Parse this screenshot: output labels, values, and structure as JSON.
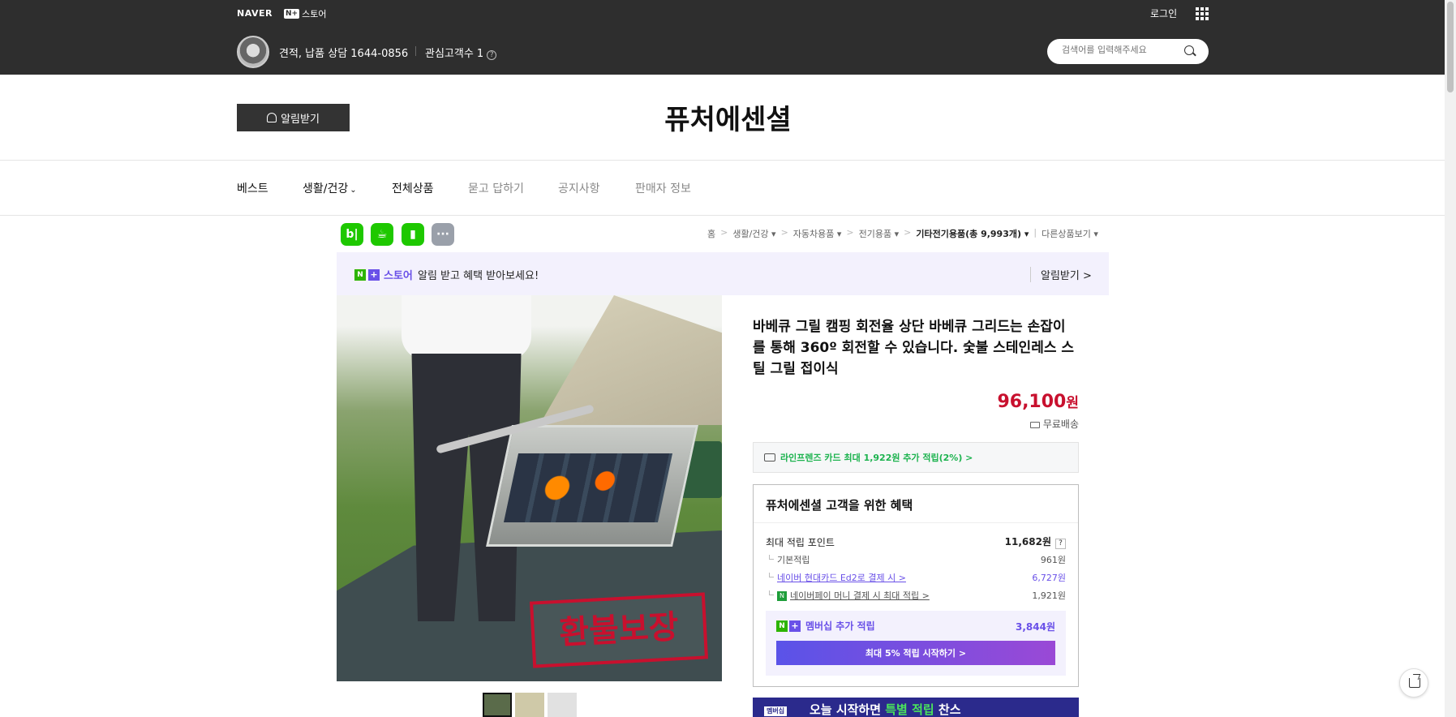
{
  "top": {
    "naver_logo": "NAVER",
    "nplus_mark": "N+",
    "nplus_label": "스토어",
    "login": "로그인",
    "consult": "견적, 납품 상담 1644-0856",
    "fans": "관심고객수 1",
    "search_placeholder": "검색어를 입력해주세요"
  },
  "store": {
    "alarm_button": "알림받기",
    "name": "퓨처에센셜"
  },
  "nav": {
    "items": [
      {
        "label": "베스트"
      },
      {
        "label": "생활/건강"
      },
      {
        "label": "전체상품"
      },
      {
        "label": "묻고 답하기"
      },
      {
        "label": "공지사항"
      },
      {
        "label": "판매자 정보"
      }
    ]
  },
  "social": {
    "blog": "b|",
    "more": "···"
  },
  "breadcrumb": {
    "items": [
      "홈",
      "생활/건강",
      "자동차용품",
      "전기용품",
      "기타전기용품(총 9,993개)",
      "다른상품보기"
    ]
  },
  "banner": {
    "mark": "N",
    "plus": "+",
    "store_word": "스토어",
    "message": "알림 받고 혜택 받아보세요!",
    "right": "알림받기 >"
  },
  "product": {
    "image_stamp": "환불보장",
    "title": "바베큐 그릴 캠핑 회전율 상단 바베큐 그리드는 손잡이를 통해 360º 회전할 수 있습니다. 숯불 스테인레스 스틸 그릴 접이식",
    "price": "96,100",
    "price_unit": "원",
    "shipping": "무료배송",
    "card_offer": "라인프렌즈 카드 최대 1,922원 추가 적립(2%) >"
  },
  "benefit": {
    "head": "퓨처에센셜 고객을 위한 혜택",
    "max_label": "최대 적립 포인트",
    "max_value": "11,682원",
    "q": "?",
    "basic_label": "기본적립",
    "basic_value": "961원",
    "hyundai_label": "네이버 현대카드 Ed2로 결제 시 >",
    "hyundai_value": "6,727원",
    "npay_label": "네이버페이 머니 결제 시 최대 적립 >",
    "npay_value": "1,921원",
    "member_label": "멤버십 추가 적립",
    "member_value": "3,844원",
    "member_button": "최대 5% 적립 시작하기 >"
  },
  "promo": {
    "badge": "멤버십",
    "text1": "오늘 시작하면 ",
    "highlight": "특별 적립",
    "text2": " 찬스"
  },
  "colors": {
    "accent_red": "#c8102e",
    "accent_purple": "#6950e8",
    "naver_green": "#2db400"
  }
}
